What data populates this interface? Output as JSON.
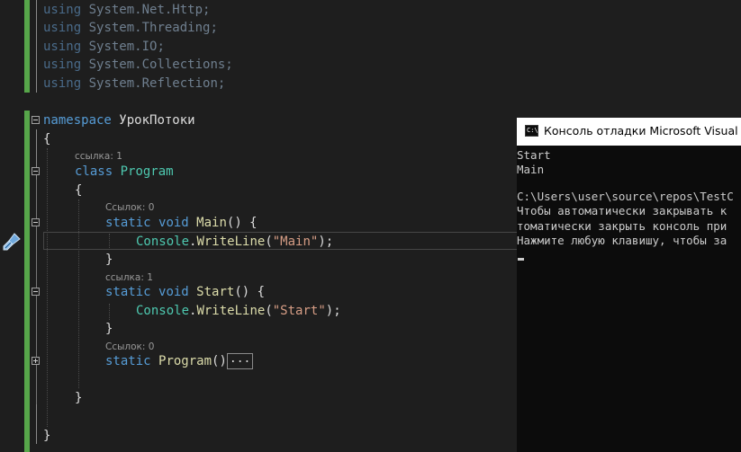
{
  "editor": {
    "usings": [
      "System.Net.Http;",
      "System.Threading;",
      "System.IO;",
      "System.Collections;",
      "System.Reflection;"
    ],
    "kw_using": "using",
    "kw_namespace": "namespace",
    "namespace_name": "УрокПотоки",
    "kw_class": "class",
    "class_name": "Program",
    "kw_static": "static",
    "kw_void": "void",
    "brace_open": "{",
    "brace_close": "}",
    "lens_class": "ссылка: 1",
    "lens_main": "Ссылок: 0",
    "lens_start": "ссылка: 1",
    "lens_ctor": "Ссылок: 0",
    "main_name": "Main",
    "start_name": "Start",
    "ctor_name": "Program",
    "parens_open": "() {",
    "parens_ctor": "()",
    "collapsed_marker": "...",
    "console_word": "Console",
    "writeline_word": "WriteLine",
    "main_string": "\"Main\"",
    "start_string": "\"Start\"",
    "call_open": ".",
    "call_paren": "(",
    "call_close": ");",
    "space": " "
  },
  "console": {
    "title": "Консоль отладки Microsoft Visual Studio",
    "icon_text": "C:\\",
    "lines": [
      "Start",
      "Main",
      "",
      "C:\\Users\\user\\source\\repos\\TestC",
      "Чтобы автоматически закрывать к",
      "томатически закрыть консоль при",
      "Нажмите любую клавишу, чтобы за"
    ]
  }
}
